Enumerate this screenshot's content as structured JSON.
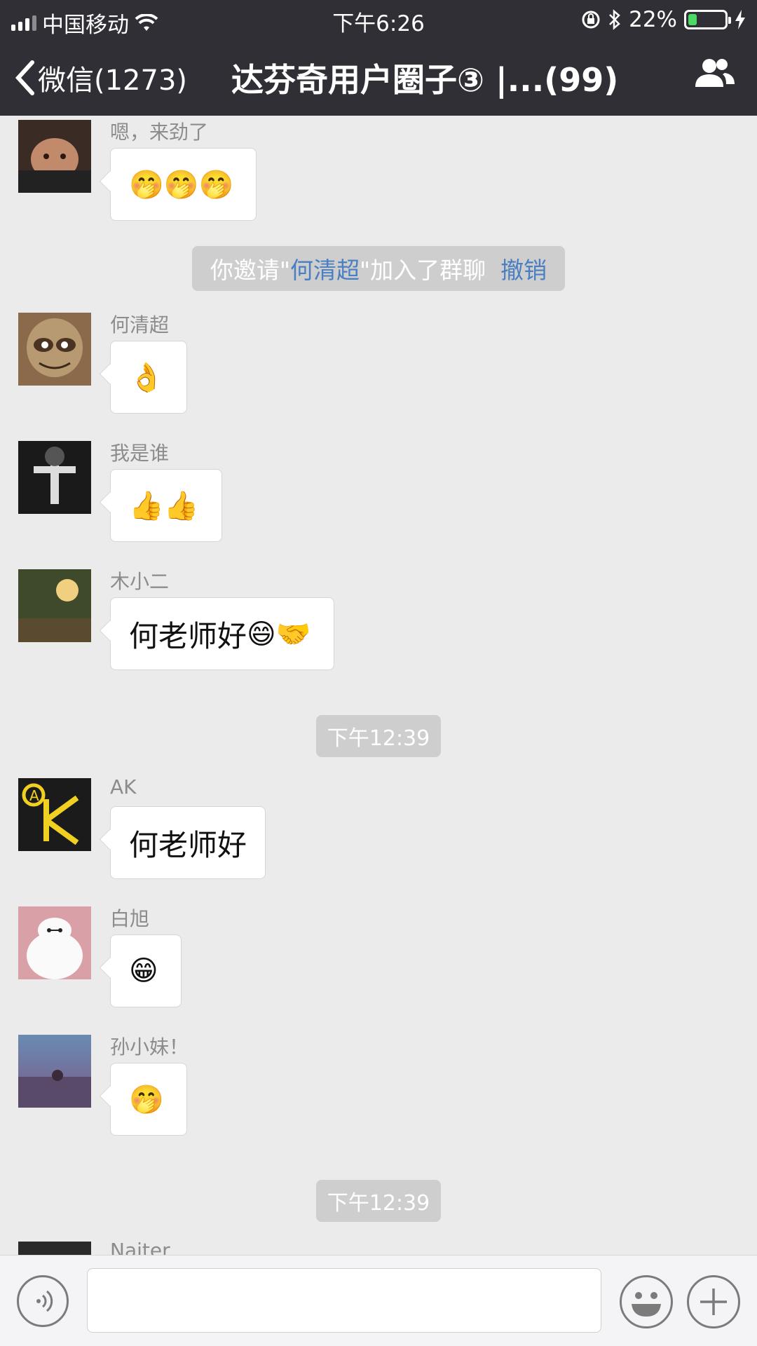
{
  "status_bar": {
    "carrier": "中国移动",
    "time": "下午6:26",
    "battery_text": "22%",
    "battery_level": 0.22
  },
  "nav": {
    "back_label": "微信(1273)",
    "title": "达芬奇用户圈子③ |...(99)",
    "back_icon": "chevron-left-icon",
    "members_icon": "group-members-icon"
  },
  "messages": [
    {
      "sender": "嗯，来劲了",
      "emoji": "🤭🤭🤭",
      "text": ""
    },
    {
      "sender": "何清超",
      "emoji": "👌",
      "text": ""
    },
    {
      "sender": "我是谁",
      "emoji": "👍👍",
      "text": ""
    },
    {
      "sender": "木小二",
      "emoji": "😄🤝",
      "text": "何老师好"
    },
    {
      "sender": "AK",
      "emoji": "",
      "text": "何老师好"
    },
    {
      "sender": "白旭",
      "emoji": "😁",
      "text": ""
    },
    {
      "sender": "孙小妹！",
      "emoji": "🤭",
      "text": ""
    },
    {
      "sender": "Naiter",
      "emoji": "",
      "text": ""
    }
  ],
  "system": {
    "invite_prefix": "你邀请\"",
    "invite_name": "何清超",
    "invite_suffix": "\"加入了群聊",
    "undo_label": "撤销",
    "time_1": "下午12:39",
    "time_2": "下午12:39"
  },
  "input_bar": {
    "placeholder": "",
    "voice_icon": "voice-icon",
    "emoji_icon": "emoji-icon",
    "plus_icon": "plus-icon"
  },
  "colors": {
    "header_bg": "#2f2f35",
    "chat_bg": "#ebebeb",
    "link_blue": "#4a7fc1",
    "battery_green": "#4cd964"
  }
}
